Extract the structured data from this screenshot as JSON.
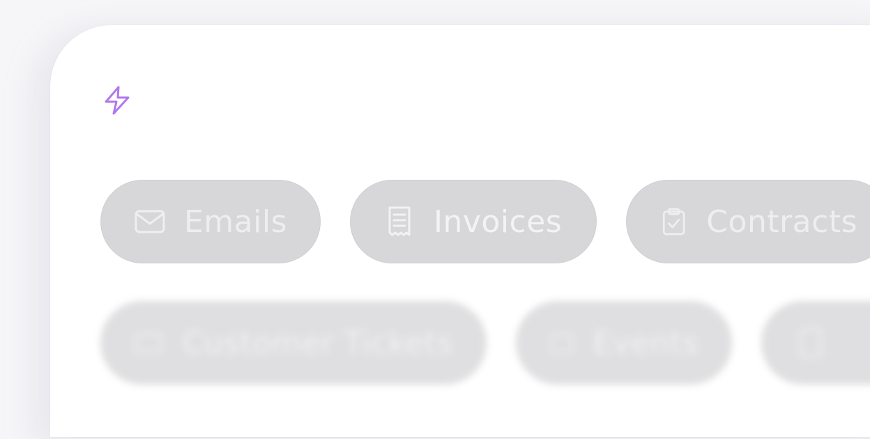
{
  "logo": {
    "icon": "lightning-bolt-icon",
    "color": "#b078ee"
  },
  "categories_row1": [
    {
      "label": "Emails",
      "icon": "envelope-icon"
    },
    {
      "label": "Invoices",
      "icon": "receipt-icon"
    },
    {
      "label": "Contracts",
      "icon": "clipboard-check-icon"
    }
  ],
  "categories_row2": [
    {
      "label": "Customer Tickets",
      "icon": "ticket-icon"
    },
    {
      "label": "Events",
      "icon": "calendar-icon"
    },
    {
      "label": "",
      "icon": "document-icon"
    }
  ]
}
